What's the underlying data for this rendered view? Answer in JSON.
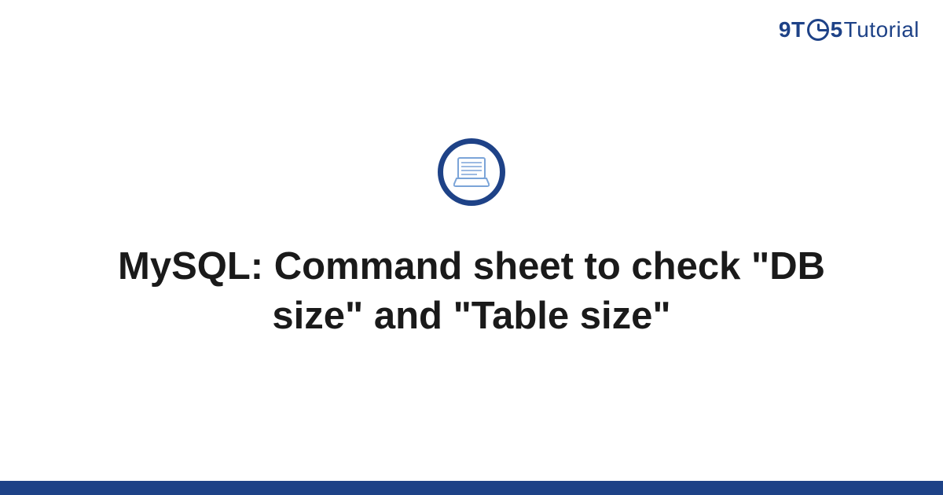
{
  "logo": {
    "part1": "9",
    "t": "T",
    "part2": "5",
    "tutorial": "Tutorial"
  },
  "title": "MySQL: Command sheet to check \"DB size\" and \"Table size\"",
  "colors": {
    "brand": "#1e4287",
    "text": "#1a1a1a",
    "laptop_stroke": "#7ba4d8"
  }
}
